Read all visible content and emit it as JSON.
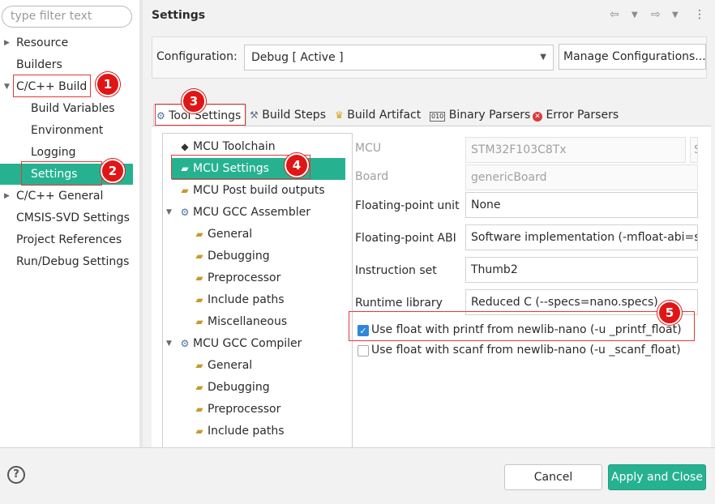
{
  "left_panel": {
    "filter_placeholder": "type filter text",
    "items": [
      {
        "label": "Resource",
        "arrow": "▶"
      },
      {
        "label": "Builders",
        "arrow": ""
      },
      {
        "label": "C/C++ Build",
        "arrow": "▼"
      },
      {
        "label": "Build Variables",
        "arrow": ""
      },
      {
        "label": "Environment",
        "arrow": ""
      },
      {
        "label": "Logging",
        "arrow": ""
      },
      {
        "label": "Settings",
        "arrow": ""
      },
      {
        "label": "C/C++ General",
        "arrow": "▶"
      },
      {
        "label": "CMSIS-SVD Settings",
        "arrow": ""
      },
      {
        "label": "Project References",
        "arrow": ""
      },
      {
        "label": "Run/Debug Settings",
        "arrow": ""
      }
    ]
  },
  "header": {
    "title": "Settings",
    "icons": [
      "back-arrow-icon",
      "dropdown-icon",
      "forward-arrow-icon",
      "dropdown-icon",
      "more-icon"
    ]
  },
  "configuration": {
    "label": "Configuration:",
    "value": "Debug  [ Active ]",
    "manage_button": "Manage Configurations..."
  },
  "tabs": [
    {
      "label": "Tool Settings",
      "icon": "gear-icon",
      "selected": true
    },
    {
      "label": "Build Steps",
      "icon": "hammer-icon",
      "selected": false
    },
    {
      "label": "Build Artifact",
      "icon": "trophy-icon",
      "selected": false
    },
    {
      "label": "Binary Parsers",
      "icon": "binary-icon",
      "selected": false
    },
    {
      "label": "Error Parsers",
      "icon": "error-icon",
      "selected": false
    }
  ],
  "tool_tree": [
    {
      "label": "MCU Toolchain",
      "icon": "chip-icon"
    },
    {
      "label": "MCU Settings",
      "icon": "folder-gear-icon"
    },
    {
      "label": "MCU Post build outputs",
      "icon": "folder-gear-icon"
    },
    {
      "label": "MCU GCC Assembler",
      "icon": "gear-icon",
      "arrow": "▼"
    },
    {
      "label": "General",
      "icon": "folder-gear-icon"
    },
    {
      "label": "Debugging",
      "icon": "folder-gear-icon"
    },
    {
      "label": "Preprocessor",
      "icon": "folder-gear-icon"
    },
    {
      "label": "Include paths",
      "icon": "folder-gear-icon"
    },
    {
      "label": "Miscellaneous",
      "icon": "folder-gear-icon"
    },
    {
      "label": "MCU GCC Compiler",
      "icon": "gear-icon",
      "arrow": "▼"
    },
    {
      "label": "General",
      "icon": "folder-gear-icon"
    },
    {
      "label": "Debugging",
      "icon": "folder-gear-icon"
    },
    {
      "label": "Preprocessor",
      "icon": "folder-gear-icon"
    },
    {
      "label": "Include paths",
      "icon": "folder-gear-icon"
    }
  ],
  "mcu_settings": {
    "mcu": {
      "label": "MCU",
      "value": "STM32F103C8Tx",
      "extra": "S"
    },
    "board": {
      "label": "Board",
      "value": "genericBoard"
    },
    "fpu": {
      "label": "Floating-point unit",
      "value": "None"
    },
    "fpabi": {
      "label": "Floating-point ABI",
      "value": "Software implementation (-mfloat-abi=sof"
    },
    "iset": {
      "label": "Instruction set",
      "value": "Thumb2"
    },
    "runtime": {
      "label": "Runtime library",
      "value": "Reduced C (--specs=nano.specs)"
    },
    "printf_float": {
      "label": "Use float with printf from newlib-nano (-u _printf_float)",
      "checked": true
    },
    "scanf_float": {
      "label": "Use float with scanf from newlib-nano (-u _scanf_float)",
      "checked": false
    }
  },
  "footer": {
    "help": "?",
    "cancel": "Cancel",
    "apply_close": "Apply and Close"
  },
  "annotations": [
    "1",
    "2",
    "3",
    "4",
    "5"
  ],
  "colors": {
    "accent": "#26b291",
    "annotation": "#e01616"
  }
}
